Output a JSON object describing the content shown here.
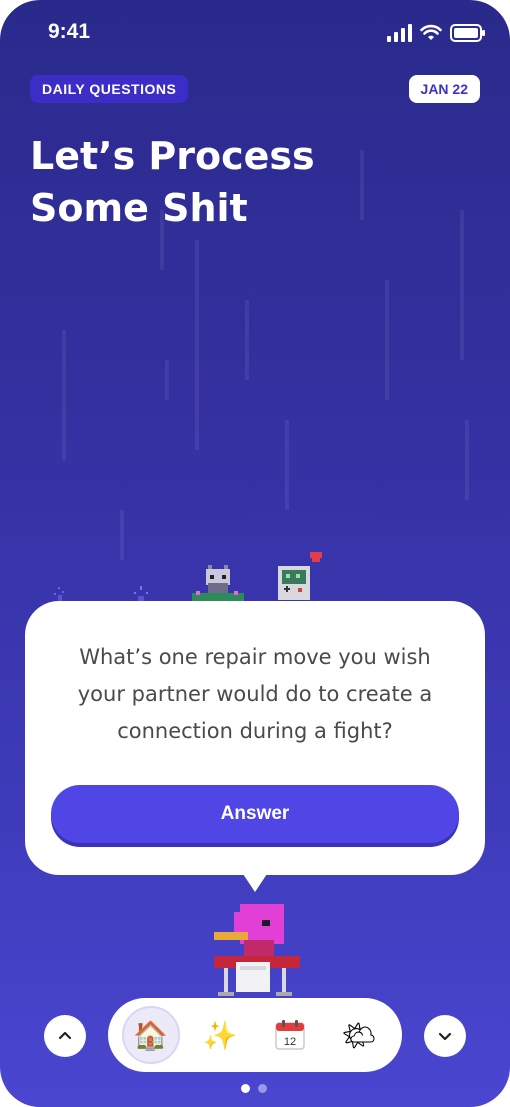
{
  "status_bar": {
    "time": "9:41"
  },
  "header": {
    "category_label": "DAILY QUESTIONS",
    "date_badge": "JAN 22",
    "title_line1": "Let’s Process",
    "title_line2": "Some Shit"
  },
  "card": {
    "question": "What’s one repair move you wish your partner would do to create a connection during a fight?",
    "answer_label": "Answer"
  },
  "calendar_day": "12",
  "nav": {
    "tabs": [
      {
        "icon": "home-icon",
        "glyph": "🏠",
        "active": true
      },
      {
        "icon": "sparkles-icon",
        "glyph": "✨",
        "active": false
      },
      {
        "icon": "calendar-icon",
        "glyph": "📅",
        "active": false
      },
      {
        "icon": "weather-icon",
        "glyph": "🌤",
        "active": false
      }
    ],
    "page_index": 1,
    "page_count": 2
  },
  "colors": {
    "background_top": "#2a2a8c",
    "background_bottom": "#4a46d0",
    "accent": "#4f46e5",
    "pill_bg": "#3b2dc6"
  }
}
